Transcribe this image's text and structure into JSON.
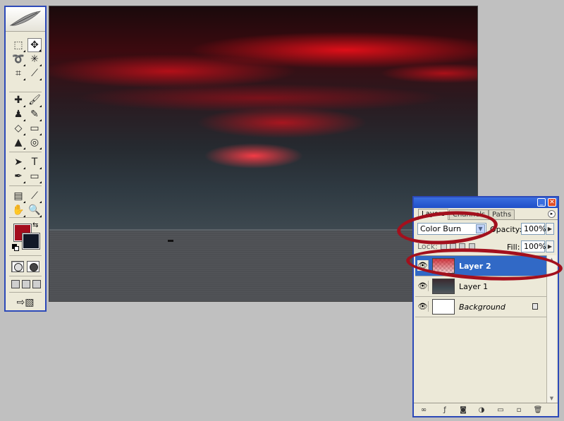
{
  "toolbox": {
    "logo_icon": "feather-icon",
    "tools": [
      {
        "id": "marquee",
        "icon": "rect-marquee-icon",
        "glyph": "⬚"
      },
      {
        "id": "move",
        "icon": "move-icon",
        "glyph": "✥"
      },
      {
        "id": "lasso",
        "icon": "lasso-icon",
        "glyph": "➰"
      },
      {
        "id": "magic-wand",
        "icon": "magic-wand-icon",
        "glyph": "✳"
      },
      {
        "id": "crop",
        "icon": "crop-icon",
        "glyph": "⌗"
      },
      {
        "id": "slice",
        "icon": "slice-icon",
        "glyph": "⟋"
      },
      {
        "id": "healing",
        "icon": "bandage-icon",
        "glyph": "✚"
      },
      {
        "id": "brush",
        "icon": "brush-icon",
        "glyph": "🖌"
      },
      {
        "id": "stamp",
        "icon": "stamp-icon",
        "glyph": "♟"
      },
      {
        "id": "history-brush",
        "icon": "history-brush-icon",
        "glyph": "✎"
      },
      {
        "id": "eraser",
        "icon": "eraser-icon",
        "glyph": "◇"
      },
      {
        "id": "gradient",
        "icon": "gradient-icon",
        "glyph": "▭"
      },
      {
        "id": "blur",
        "icon": "blur-icon",
        "glyph": "▲"
      },
      {
        "id": "dodge",
        "icon": "dodge-icon",
        "glyph": "◎"
      },
      {
        "id": "path-select",
        "icon": "arrow-icon",
        "glyph": "➤"
      },
      {
        "id": "type",
        "icon": "type-icon",
        "glyph": "T"
      },
      {
        "id": "pen",
        "icon": "pen-icon",
        "glyph": "✒"
      },
      {
        "id": "shape",
        "icon": "rectangle-icon",
        "glyph": "▭"
      },
      {
        "id": "notes",
        "icon": "notes-icon",
        "glyph": "▤"
      },
      {
        "id": "eyedropper",
        "icon": "eyedropper-icon",
        "glyph": "⟋"
      },
      {
        "id": "hand",
        "icon": "hand-icon",
        "glyph": "✋"
      },
      {
        "id": "zoom",
        "icon": "zoom-icon",
        "glyph": "🔍"
      }
    ],
    "foreground_color": "#a30d1d",
    "background_color": "#111827"
  },
  "layers_panel": {
    "tabs": [
      "Layers",
      "Channels",
      "Paths"
    ],
    "blend_mode": "Color Burn",
    "opacity_label": "Opacity:",
    "opacity_value": "100%",
    "lock_label": "Lock:",
    "fill_label": "Fill:",
    "fill_value": "100%",
    "layers": [
      {
        "name": "Layer 2",
        "selected": true,
        "visible": true
      },
      {
        "name": "Layer 1",
        "selected": false,
        "visible": true
      },
      {
        "name": "Background",
        "selected": false,
        "visible": true,
        "locked": true
      }
    ],
    "annotation_color": "#a3101d"
  }
}
